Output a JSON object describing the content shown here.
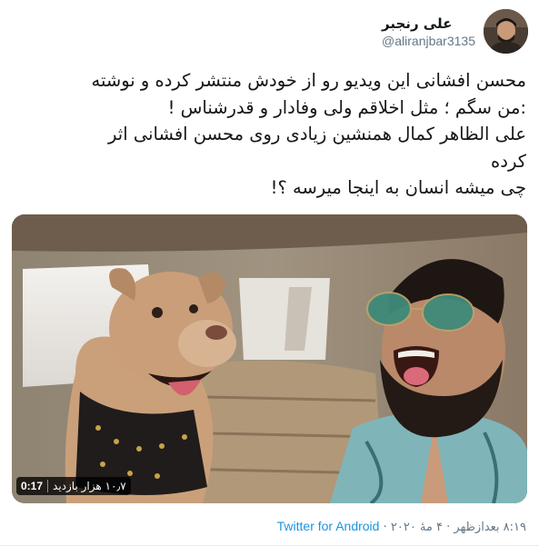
{
  "author": {
    "display_name": "علی رنجبر",
    "handle": "@aliranjbar3135"
  },
  "tweet": {
    "lines": [
      "محسن افشانی این ویدیو رو از خودش منتشر کرده و نوشته",
      ":من سگم ؛ مثل اخلاقم ولی وفادار و قدرشناس !",
      "علی الظاهر کمال همنشین زیادی روی محسن افشانی اثر",
      "کرده",
      "چی میشه انسان به اینجا میرسه ؟!"
    ]
  },
  "media": {
    "duration": "0:17",
    "views": "۱۰٫۷ هزار بازدید"
  },
  "meta": {
    "time": "۸:۱۹ بعدازظهر",
    "separator1": "·",
    "date": "۴ مهٔ ۲۰۲۰",
    "separator2": "·",
    "source": "Twitter for Android"
  },
  "colors": {
    "text": "#14171a",
    "secondary": "#657786",
    "link": "#1b95e0"
  }
}
